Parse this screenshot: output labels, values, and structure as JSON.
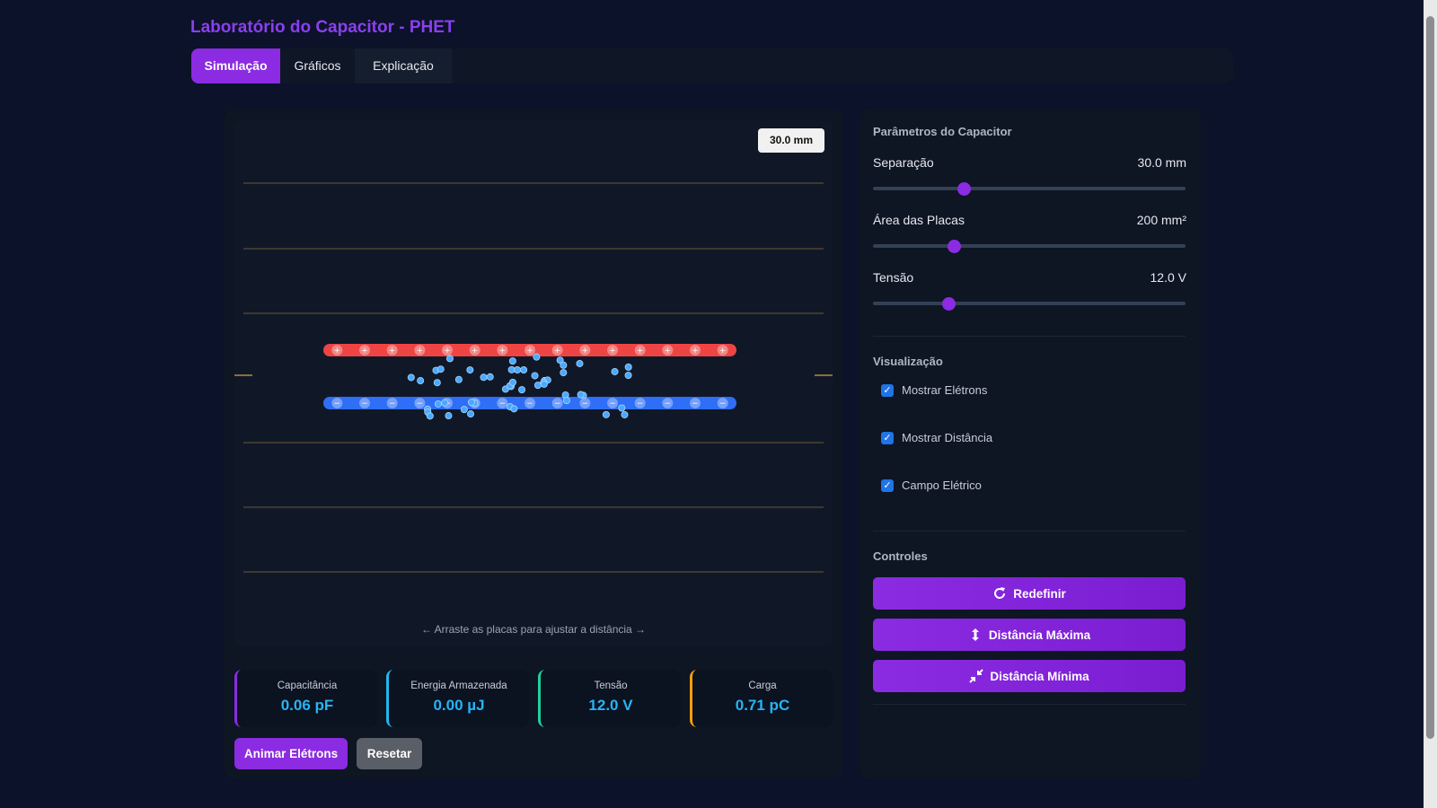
{
  "app": {
    "title": "Laboratório do Capacitor - PHET"
  },
  "tabs": [
    {
      "label": "Simulação",
      "active": true
    },
    {
      "label": "Gráficos",
      "active": false
    },
    {
      "label": "Explicação",
      "active": false
    }
  ],
  "simulation": {
    "distance_badge": "30.0 mm",
    "drag_hint": "← Arraste as placas para ajustar a distância →",
    "positive_plate_symbol": "+",
    "negative_plate_symbol": "−",
    "positive_charge_count": 15,
    "negative_charge_count": 15,
    "free_electron_count": 52
  },
  "stats": [
    {
      "label": "Capacitância",
      "value": "0.06 pF"
    },
    {
      "label": "Energia Armazenada",
      "value": "0.00 µJ"
    },
    {
      "label": "Tensão",
      "value": "12.0 V"
    },
    {
      "label": "Carga",
      "value": "0.71 pC"
    }
  ],
  "buttons": {
    "animate": "Animar Elétrons",
    "reset": "Resetar"
  },
  "parameters": {
    "title": "Parâmetros do Capacitor",
    "sliders": [
      {
        "label": "Separação",
        "value": "30.0 mm",
        "fraction": 0.29
      },
      {
        "label": "Área das Placas",
        "value": "200 mm²",
        "fraction": 0.26
      },
      {
        "label": "Tensão",
        "value": "12.0 V",
        "fraction": 0.24
      }
    ]
  },
  "visualization": {
    "title": "Visualização",
    "options": [
      {
        "label": "Mostrar Elétrons",
        "checked": true
      },
      {
        "label": "Mostrar Distância",
        "checked": true
      },
      {
        "label": "Campo Elétrico",
        "checked": true
      }
    ]
  },
  "controls": {
    "title": "Controles",
    "reset": "Redefinir",
    "max_distance": "Distância Máxima",
    "min_distance": "Distância Mínima"
  },
  "colors": {
    "accent": "#8b2be2",
    "title": "#8b3ff0",
    "positive_plate": "#ef4444",
    "negative_plate": "#2f6ef6",
    "value_text": "#27b4f5",
    "field_line": "#8a6d3b"
  }
}
